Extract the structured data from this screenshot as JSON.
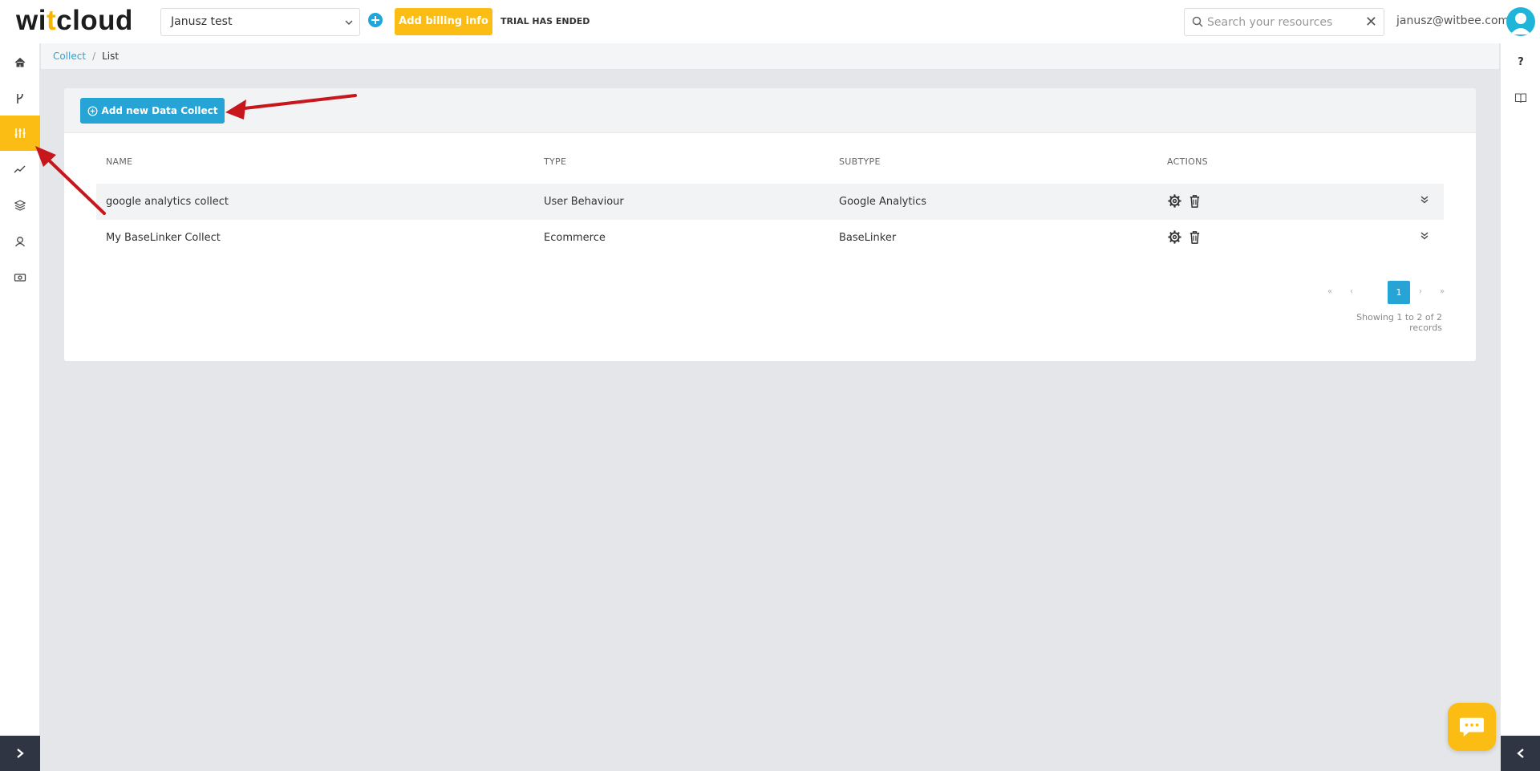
{
  "header": {
    "logo_prefix": "wi",
    "logo_accent": "t",
    "logo_suffix": "cloud",
    "org_selected": "Janusz test",
    "billing_label": "Add billing info",
    "trial_label": "TRIAL HAS ENDED",
    "search_placeholder": "Search your resources",
    "user_email": "janusz@witbee.com"
  },
  "sidebar": {
    "items": [
      {
        "icon": "home-icon"
      },
      {
        "icon": "flow-icon"
      },
      {
        "icon": "sliders-icon",
        "active": true
      },
      {
        "icon": "chart-line-icon"
      },
      {
        "icon": "layers-icon"
      },
      {
        "icon": "user-icon"
      },
      {
        "icon": "money-icon"
      }
    ]
  },
  "right_sidebar": {
    "help_label": "?"
  },
  "breadcrumb": {
    "root": "Collect",
    "separator": "/",
    "current": "List"
  },
  "toolbar": {
    "add_label": "Add new Data Collect"
  },
  "table": {
    "columns": [
      "NAME",
      "TYPE",
      "SUBTYPE",
      "ACTIONS"
    ],
    "rows": [
      {
        "name": "google analytics collect",
        "type": "User Behaviour",
        "subtype": "Google Analytics"
      },
      {
        "name": "My BaseLinker Collect",
        "type": "Ecommerce",
        "subtype": "BaseLinker"
      }
    ]
  },
  "pagination": {
    "first": "«",
    "prev": "‹",
    "current": "1",
    "next": "›",
    "last": "»",
    "records_text": "Showing 1 to 2 of 2 records"
  },
  "colors": {
    "accent_yellow": "#fbbd13",
    "accent_blue": "#26a4d6",
    "arrow_red": "#c8161d"
  }
}
